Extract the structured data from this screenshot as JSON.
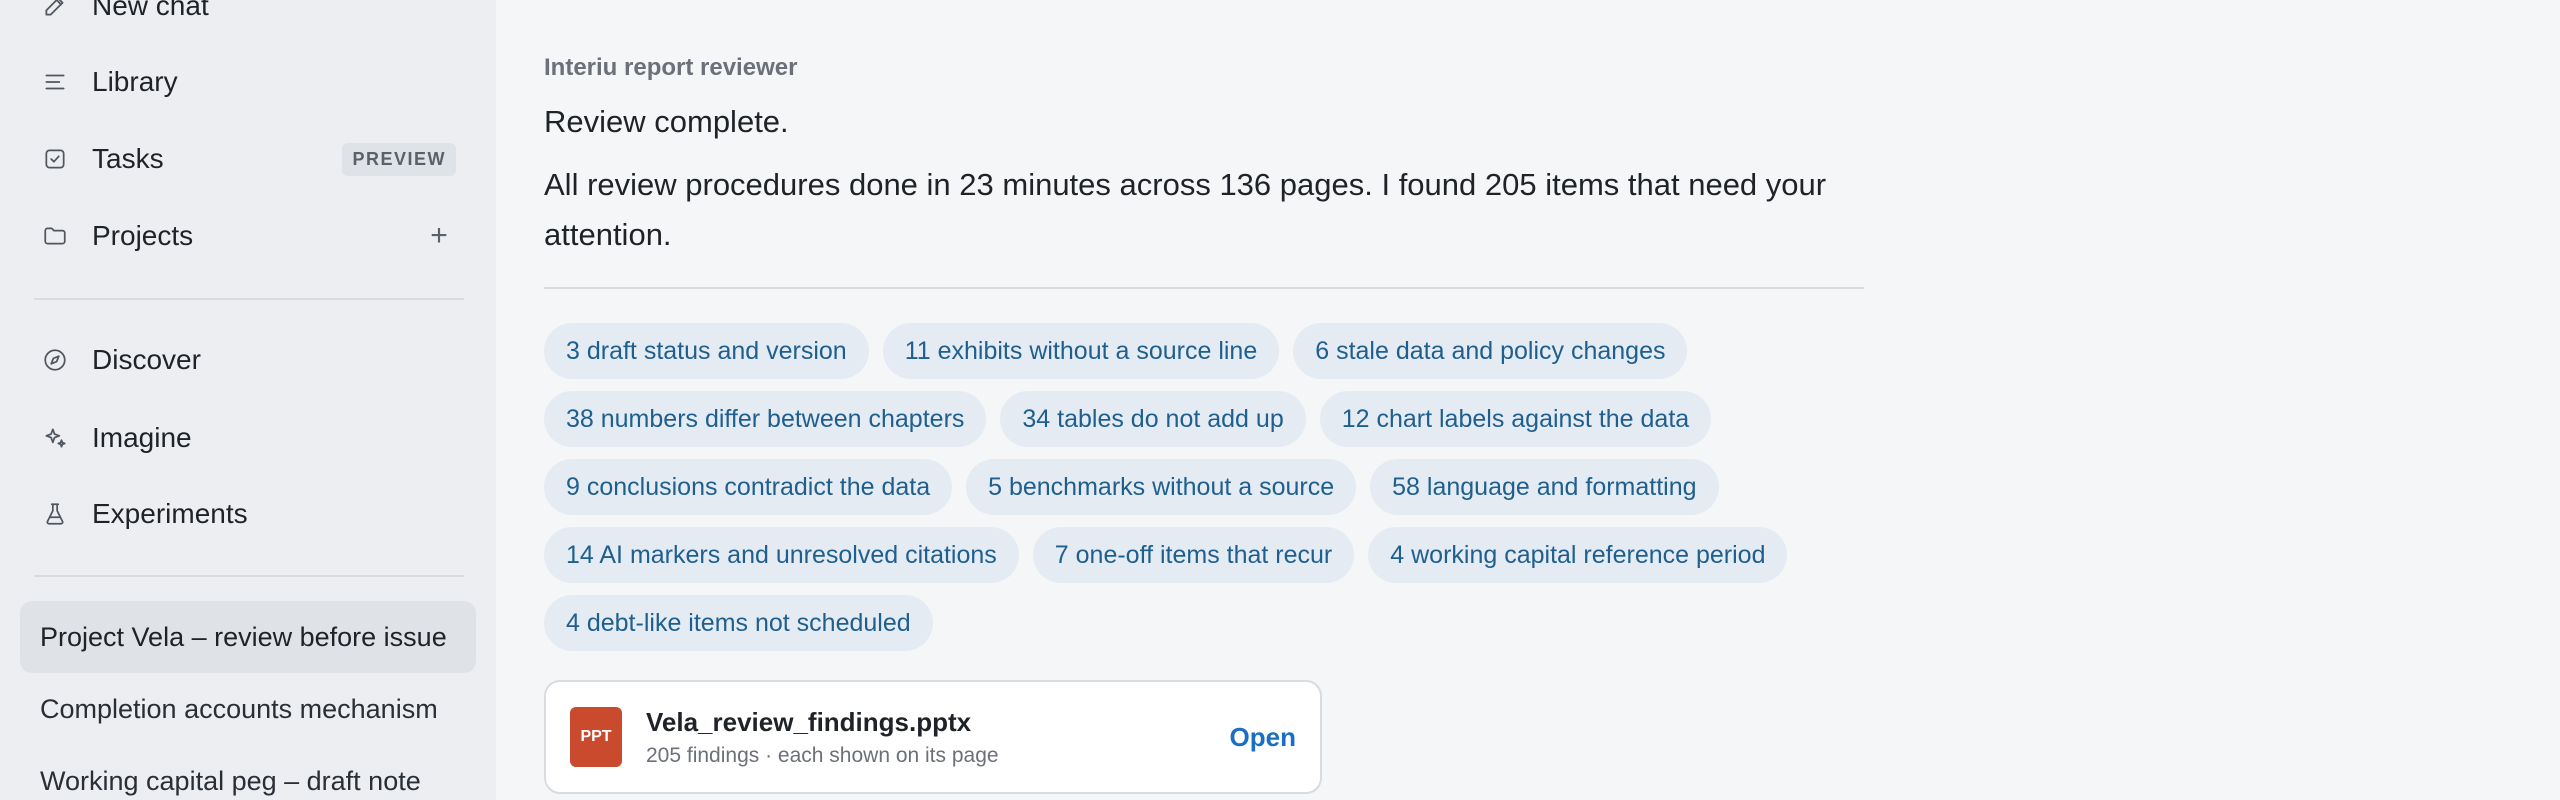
{
  "sidebar": {
    "nav": [
      {
        "label": "New chat",
        "icon": "pencil-icon"
      },
      {
        "label": "Library",
        "icon": "list-icon"
      },
      {
        "label": "Tasks",
        "icon": "checkbox-icon",
        "badge": "PREVIEW"
      },
      {
        "label": "Projects",
        "icon": "folder-icon",
        "action": "+"
      }
    ],
    "nav2": [
      {
        "label": "Discover",
        "icon": "compass-icon"
      },
      {
        "label": "Imagine",
        "icon": "sparkle-icon"
      },
      {
        "label": "Experiments",
        "icon": "flask-icon"
      }
    ],
    "chats": [
      {
        "label": "Project Vela – review before issue",
        "active": true
      },
      {
        "label": "Completion accounts mechanism"
      },
      {
        "label": "Working capital peg – draft note"
      }
    ]
  },
  "message": {
    "agent": "Interiu report reviewer",
    "line1": "Review complete.",
    "line2": "All review procedures done in 23 minutes across 136 pages. I found 205 items that need your attention."
  },
  "chips": [
    [
      "3 draft status and version",
      "11 exhibits without a source line",
      "6 stale data and policy changes"
    ],
    [
      "38 numbers differ between chapters",
      "34 tables do not add up",
      "12 chart labels against the data"
    ],
    [
      "9 conclusions contradict the data",
      "5 benchmarks without a source",
      "58 language and formatting"
    ],
    [
      "14 AI markers and unresolved citations",
      "7 one-off items that recur",
      "4 working capital reference period"
    ],
    [
      "4 debt-like items not scheduled"
    ]
  ],
  "file": {
    "type": "PPT",
    "name": "Vela_review_findings.pptx",
    "meta": "205 findings · each shown on its page",
    "action": "Open"
  },
  "colors": {
    "sidebar_bg": "#eceef2",
    "main_bg": "#f5f6f8",
    "chip_bg": "#e4ebf3",
    "chip_text": "#1f5f8e",
    "link": "#1a6fc4",
    "ppt": "#c94a2c"
  }
}
